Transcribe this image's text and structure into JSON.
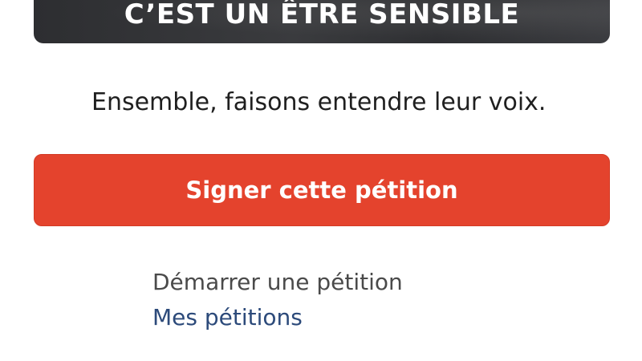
{
  "hero": {
    "title": "C’EST UN ÊTRE SENSIBLE"
  },
  "tagline": "Ensemble, faisons entendre leur voix.",
  "cta": {
    "sign_label": "Signer cette pétition",
    "color": "#e4432d"
  },
  "nav": {
    "start_petition": "Démarrer une pétition",
    "my_petitions": "Mes pétitions",
    "link_color": "#2c4a7a"
  }
}
